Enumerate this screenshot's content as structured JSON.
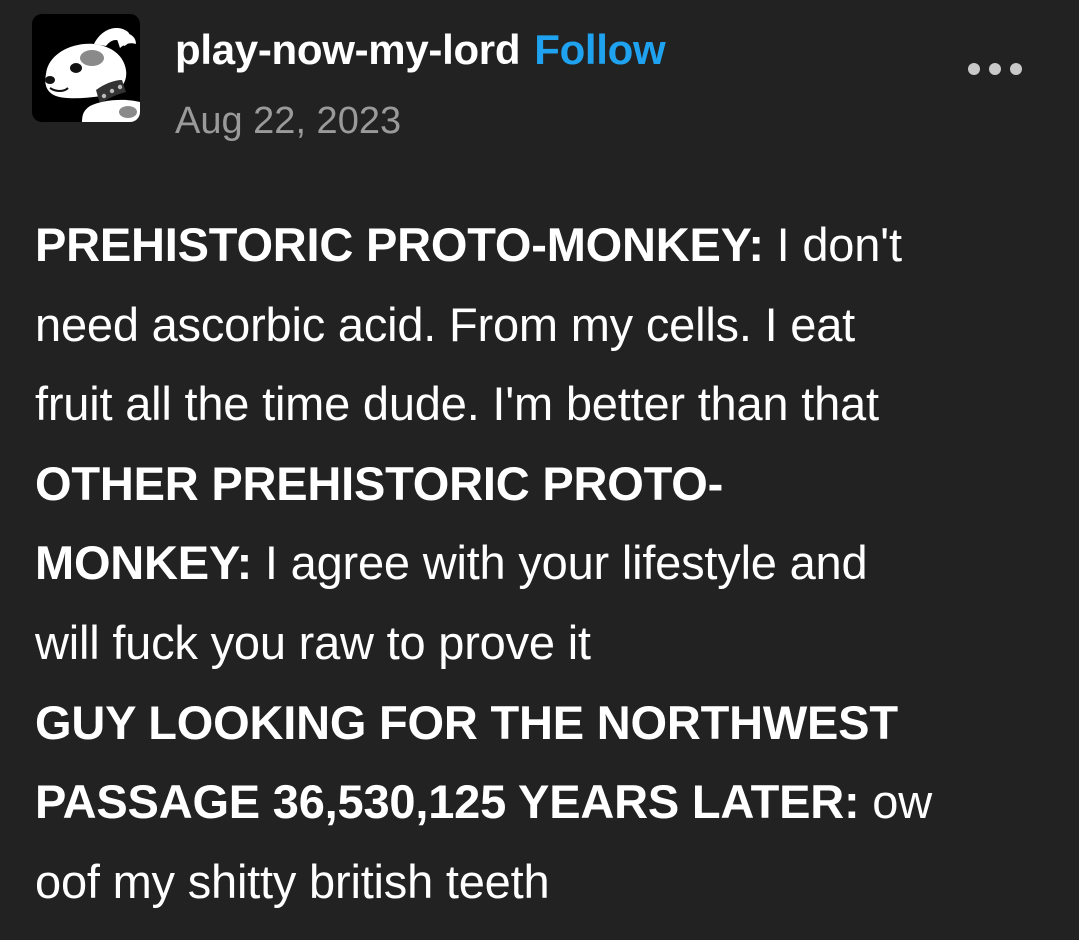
{
  "post": {
    "username": "play-now-my-lord",
    "follow_label": "Follow",
    "date": "Aug 22, 2023",
    "more_icon": "ellipsis-icon",
    "avatar_icon": "cartoon-dog-avatar",
    "colors": {
      "background": "#222222",
      "text": "#ffffff",
      "follow": "#1fa3f0",
      "date": "#9a9a9a"
    },
    "lines": [
      {
        "speaker": "PREHISTORIC PROTO-MONKEY:",
        "text": " I don't"
      },
      {
        "speaker": "",
        "text": "need ascorbic acid. From my cells. I eat"
      },
      {
        "speaker": "",
        "text": "fruit all the time dude. I'm better than that"
      },
      {
        "speaker": "OTHER PREHISTORIC PROTO-",
        "text": ""
      },
      {
        "speaker": "MONKEY:",
        "text": " I agree with your lifestyle and"
      },
      {
        "speaker": "",
        "text": "will fuck you raw to prove it"
      },
      {
        "speaker": "GUY LOOKING FOR THE NORTHWEST",
        "text": ""
      },
      {
        "speaker": "PASSAGE 36,530,125 YEARS LATER:",
        "text": " ow"
      },
      {
        "speaker": "",
        "text": "oof my shitty british teeth"
      }
    ]
  }
}
